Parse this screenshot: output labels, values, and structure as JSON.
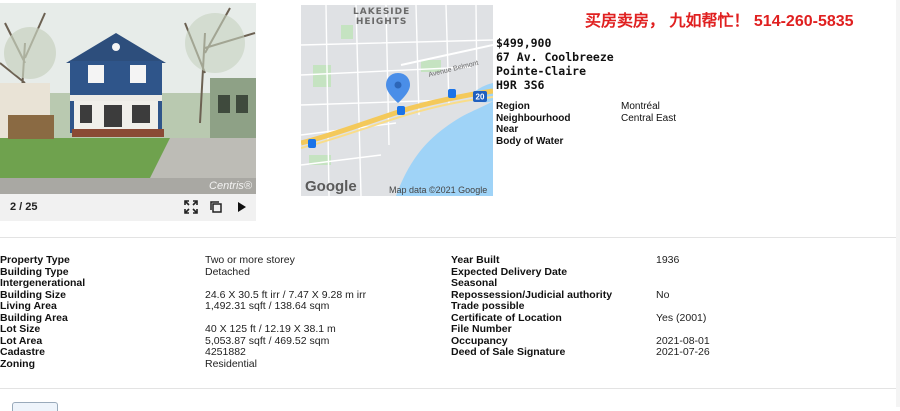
{
  "listing": {
    "price": "$499,900",
    "street": "67 Av. Coolbreeze",
    "city": "Pointe-Claire",
    "postal": "H9R 3S6"
  },
  "promo": "买房卖房， 九如帮忙！ 514-260-5835",
  "photo": {
    "counter": "2 / 25",
    "watermark": "Centris®",
    "controls": [
      "fullscreen-icon",
      "copy-icon",
      "next-icon"
    ]
  },
  "map": {
    "area_label_line1": "LAKESIDE",
    "area_label_line2": "HEIGHTS",
    "street_label": "Avenue Belmont",
    "highway_shield": "20",
    "credit": "Map data ©2021 Google",
    "logo": "Google"
  },
  "location": {
    "labels": [
      "Region",
      "Neighbourhood",
      "Near",
      "Body of Water"
    ],
    "values": [
      "Montréal",
      "Central East",
      "",
      ""
    ]
  },
  "details_left": {
    "labels": [
      "Property Type",
      "Building Type",
      "Intergenerational",
      "Building Size",
      "Living Area",
      "Building Area",
      "Lot Size",
      "Lot Area",
      "Cadastre",
      "Zoning"
    ],
    "values": [
      "Two or more storey",
      "Detached",
      "",
      "24.6 X 30.5 ft irr / 7.47 X 9.28 m irr",
      "1,492.31 sqft / 138.64 sqm",
      "",
      "40 X 125 ft / 12.19 X 38.1 m",
      "5,053.87 sqft / 469.52 sqm",
      "4251882",
      "Residential"
    ]
  },
  "details_right": {
    "labels": [
      "Year Built",
      "Expected Delivery Date",
      "Seasonal",
      "Repossession/Judicial authority",
      "Trade possible",
      "Certificate of Location",
      "File Number",
      "Occupancy",
      "Deed of Sale Signature"
    ],
    "values": [
      "1936",
      "",
      "",
      "No",
      "",
      "Yes (2001)",
      "",
      "2021-08-01",
      "2021-07-26"
    ]
  },
  "colors": {
    "promo": "#e02020",
    "map_water": "#9fd3f7",
    "map_land": "#dfe1e4",
    "map_park": "#c5e3c1",
    "highway": "#f4c95a",
    "pin": "#4a8ee8"
  }
}
